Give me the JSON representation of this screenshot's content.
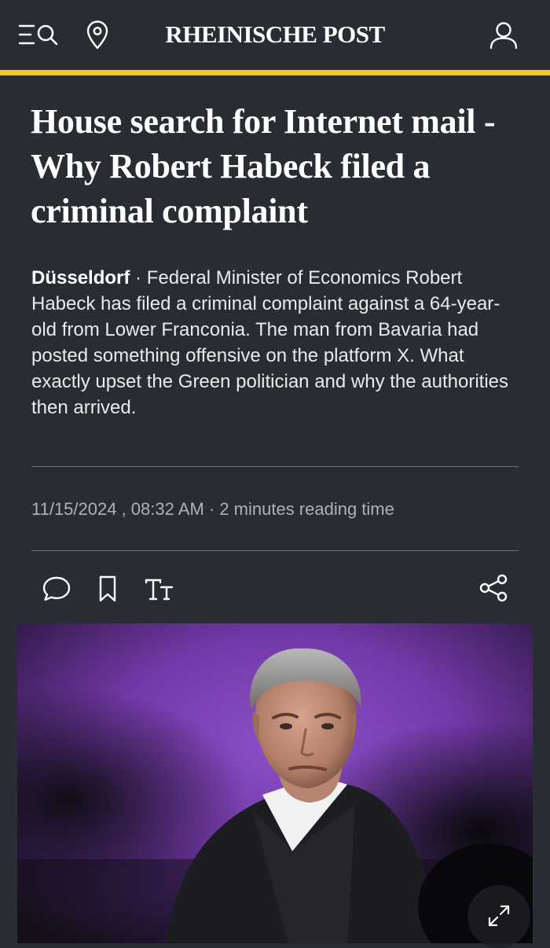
{
  "header": {
    "logo": "RHEINISCHE POST",
    "icons": [
      "menu-icon",
      "search-icon",
      "location-pin-icon",
      "user-icon"
    ]
  },
  "article": {
    "headline": "House search for Internet mail - Why Robert Habeck filed a criminal complaint",
    "dateline": "Düsseldorf",
    "separator": " · ",
    "lead": "Federal Minister of Economics Robert Habeck has filed a criminal complaint against a 64-year-old from Lower Franconia. The man from Bavaria had posted something offensive on the platform X. What exactly upset the Green politician and why the authorities then arrived.",
    "meta": "11/15/2024 , 08:32 AM · 2 minutes reading time"
  },
  "actions": {
    "icons": [
      "comment-icon",
      "bookmark-icon",
      "text-size-icon",
      "share-icon"
    ]
  },
  "media": {
    "expand_icon": "expand-icon"
  },
  "colors": {
    "background": "#292c33",
    "accent": "#f5c518",
    "text": "#ffffff",
    "muted": "#aeb1b7",
    "photo_backdrop": "#7a3fb1"
  }
}
